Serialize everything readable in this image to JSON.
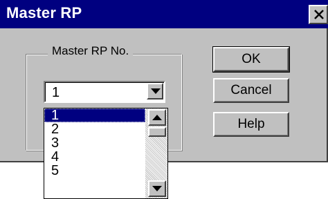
{
  "window": {
    "title": "Master RP"
  },
  "group": {
    "label": "Master RP No."
  },
  "combo": {
    "value": "1"
  },
  "dropdown": {
    "items": [
      "1",
      "2",
      "3",
      "4",
      "5"
    ],
    "selected": "1"
  },
  "buttons": {
    "ok": "OK",
    "cancel": "Cancel",
    "help": "Help"
  },
  "colors": {
    "titlebar": "#000080",
    "face": "#c0c0c0",
    "selection": "#000080"
  },
  "icons": {
    "close": "close-icon",
    "dropdown_arrow": "chevron-down-icon",
    "scroll_up": "chevron-up-icon",
    "scroll_down": "chevron-down-icon"
  }
}
